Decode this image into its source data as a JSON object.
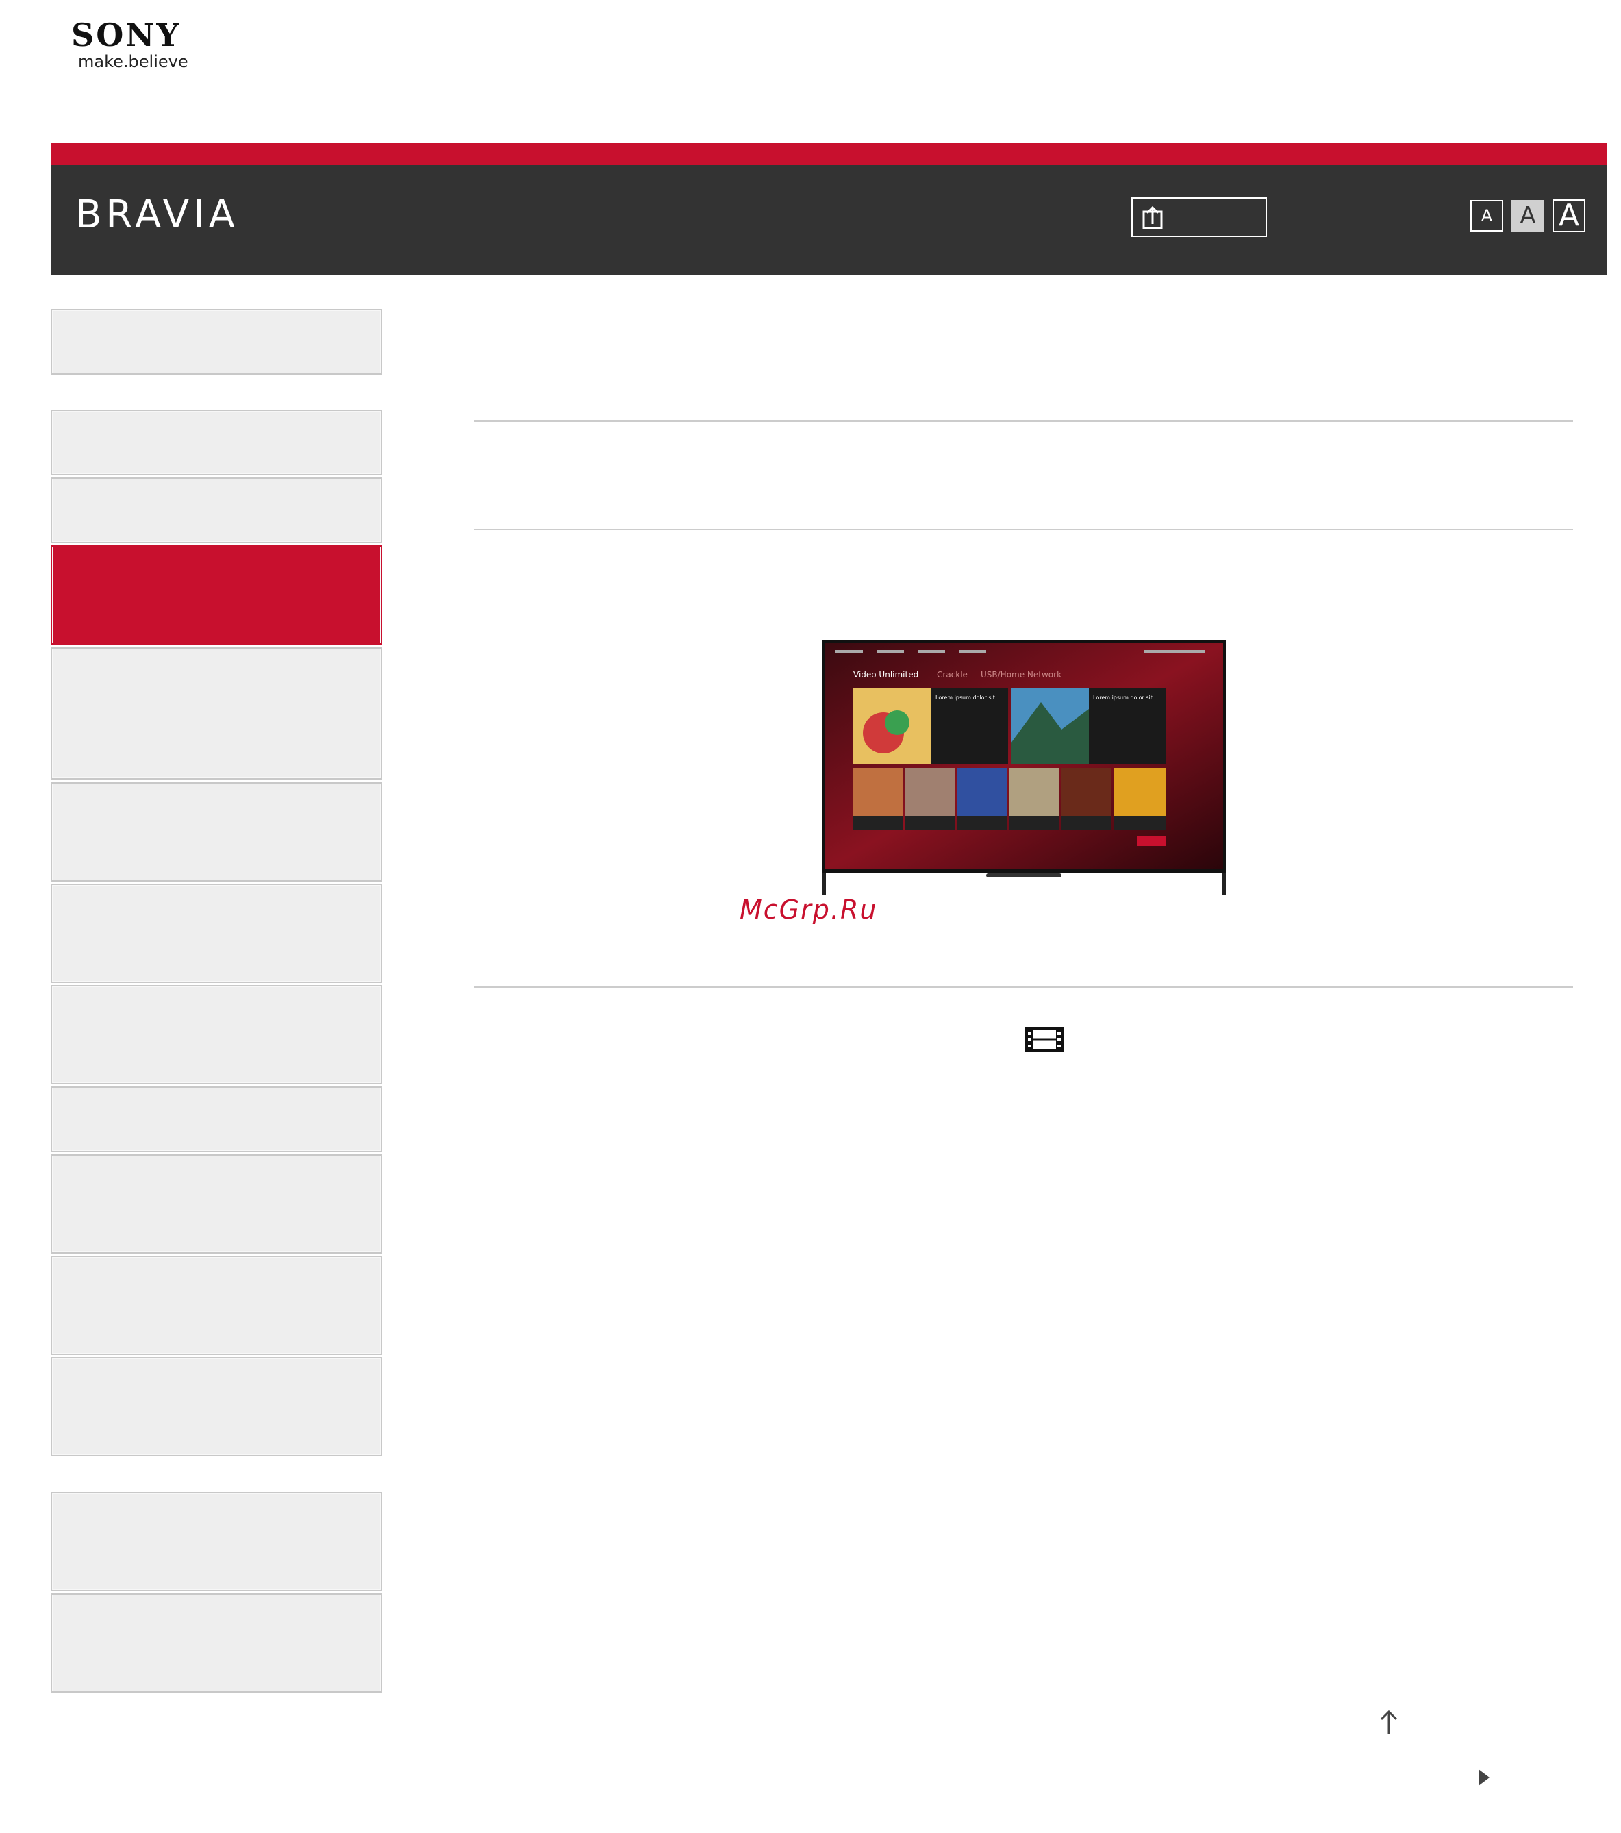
{
  "logo": {
    "brand": "SONY",
    "tagline": "make.believe"
  },
  "header": {
    "title": "BRAVIA",
    "share_icon": "share-upload-icon",
    "font_size_labels": [
      "A",
      "A",
      "A"
    ]
  },
  "colors": {
    "accent": "#c8102e",
    "header_bg": "#333333",
    "nav_bg": "#eeeeee"
  },
  "sidebar": {
    "items": [
      "",
      "",
      "",
      "",
      "",
      "",
      "",
      "",
      "",
      "",
      "",
      "",
      "",
      ""
    ],
    "active_index": 3
  },
  "content": {
    "image": {
      "tabs": [
        "Video Unlimited",
        "Crackle",
        "USB/Home Network"
      ],
      "tile_titles": [
        "Lorem ipsum dolor sit...",
        "Lorem ipsum dolor sit..."
      ]
    },
    "watermark": "McGrp.Ru",
    "film_icon": "film-strip-icon"
  },
  "footer": {
    "top_icon": "arrow-up-icon",
    "next_icon": "triangle-right-icon"
  }
}
